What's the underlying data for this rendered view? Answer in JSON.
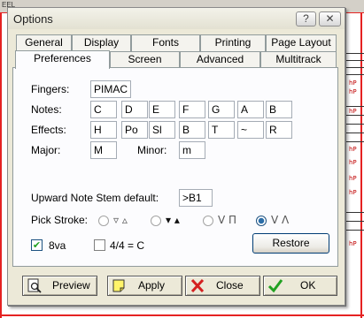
{
  "window": {
    "title": "Options",
    "help_label": "?",
    "close_label": "✕"
  },
  "tabs_row1": [
    "General",
    "Display",
    "Fonts",
    "Printing",
    "Page Layout"
  ],
  "tabs_row2": [
    "Preferences",
    "Screen",
    "Advanced",
    "Multitrack"
  ],
  "active_tab": "Preferences",
  "fingers": {
    "label": "Fingers:",
    "value": "PIMAC"
  },
  "notes": {
    "label": "Notes:",
    "values": [
      "C",
      "D",
      "E",
      "F",
      "G",
      "A",
      "B"
    ]
  },
  "effects": {
    "label": "Effects:",
    "values": [
      "H",
      "Po",
      "Sl",
      "B",
      "T",
      "~",
      "R"
    ]
  },
  "major": {
    "label": "Major:",
    "value": "M"
  },
  "minor": {
    "label": "Minor:",
    "value": "m"
  },
  "stem": {
    "label": "Upward Note Stem default:",
    "value": ">B1"
  },
  "pick_stroke": {
    "label": "Pick Stroke:",
    "options": [
      {
        "symbols": "▿ ▵",
        "selected": false
      },
      {
        "symbols": "▾ ▴",
        "selected": false
      },
      {
        "symbols": "V Π",
        "selected": false
      },
      {
        "symbols": "V Λ",
        "selected": true
      }
    ]
  },
  "checks": [
    {
      "label": "8va",
      "checked": true
    },
    {
      "label": "4/4 = C",
      "checked": false
    }
  ],
  "restore_label": "Restore",
  "buttons": {
    "preview": "Preview",
    "apply": "Apply",
    "close": "Close",
    "ok": "OK"
  },
  "background": {
    "toolbar_text": "EEL",
    "marks": [
      "hP",
      "hP",
      "hP",
      "hP",
      "hP",
      "hP",
      "hP",
      "hP"
    ]
  },
  "colors": {
    "accent": "#1c5180",
    "close_x": "#d42020",
    "ok_check": "#21a121",
    "frame": "#ece9d8"
  }
}
